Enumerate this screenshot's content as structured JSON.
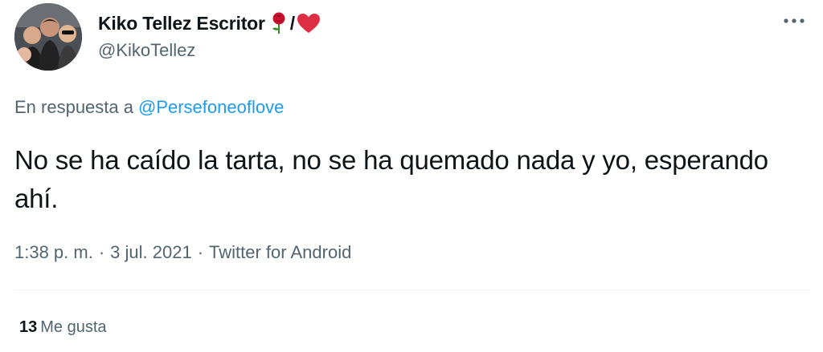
{
  "author": {
    "display_name": "Kiko Tellez Escritor",
    "slash": "/",
    "handle": "@KikoTellez",
    "name_icons": [
      "rose-icon",
      "red-heart-icon"
    ],
    "avatar_icon": "profile-avatar"
  },
  "reply": {
    "prefix": "En respuesta a",
    "mention": "@Persefoneoflove"
  },
  "tweet": {
    "text": "No se ha caído la tarta, no se ha quemado nada y yo, esperando ahí."
  },
  "meta": {
    "time": "1:38 p. m.",
    "separator": "·",
    "date": "3 jul. 2021",
    "source": "Twitter for Android"
  },
  "stats": {
    "likes_count": "13",
    "likes_label": "Me gusta"
  },
  "colors": {
    "text": "#0f1419",
    "secondary": "#536471",
    "link": "#1d9bf0",
    "heart": "#e0245e",
    "divider": "#eff3f4"
  },
  "more_icon": "more-horizontal-icon"
}
